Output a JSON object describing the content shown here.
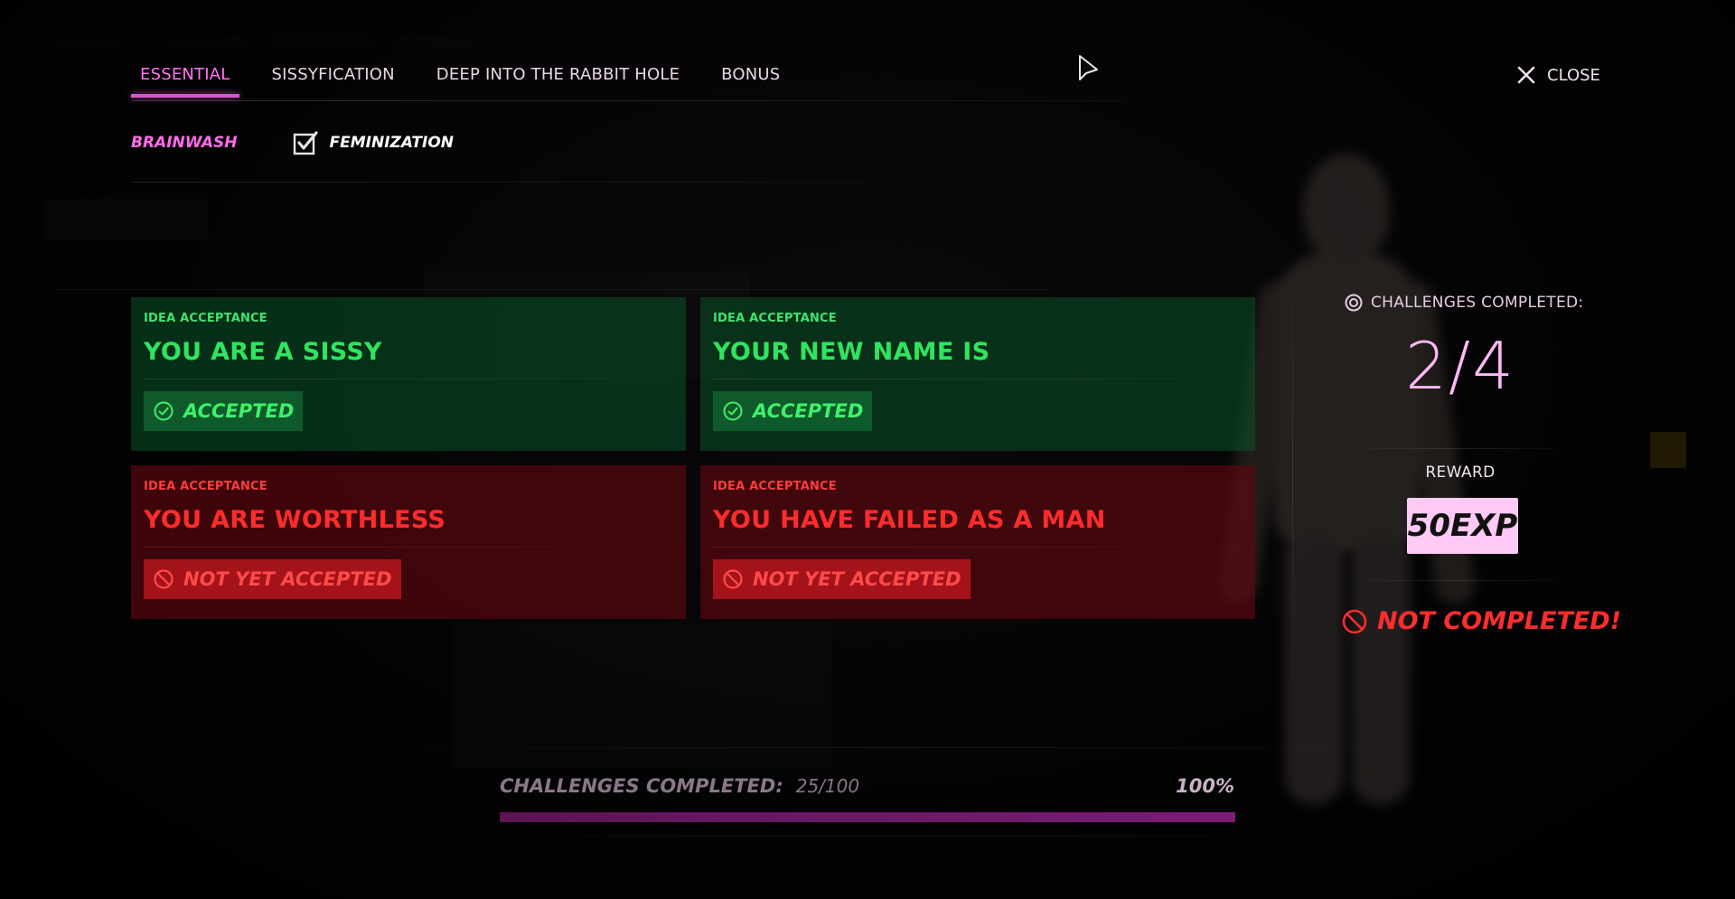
{
  "tabs": [
    {
      "label": "ESSENTIAL",
      "active": true
    },
    {
      "label": "SISSYFICATION",
      "active": false
    },
    {
      "label": "DEEP INTO THE RABBIT HOLE",
      "active": false
    },
    {
      "label": "BONUS",
      "active": false
    }
  ],
  "close_label": "CLOSE",
  "subtabs": [
    {
      "label": "BRAINWASH",
      "active": true
    },
    {
      "label": "FEMINIZATION",
      "active": false,
      "icon": "checkbox-checked-icon"
    }
  ],
  "cards": [
    {
      "category": "IDEA ACCEPTANCE",
      "title": "YOU ARE A SISSY",
      "status": "ACCEPTED",
      "state": "accepted"
    },
    {
      "category": "IDEA ACCEPTANCE",
      "title": "YOUR NEW NAME IS",
      "status": "ACCEPTED",
      "state": "accepted"
    },
    {
      "category": "IDEA ACCEPTANCE",
      "title": "YOU ARE WORTHLESS",
      "status": "NOT YET ACCEPTED",
      "state": "pending"
    },
    {
      "category": "IDEA ACCEPTANCE",
      "title": "YOU HAVE FAILED AS A MAN",
      "status": "NOT YET ACCEPTED",
      "state": "pending"
    }
  ],
  "panel": {
    "challenges_label": "CHALLENGES COMPLETED:",
    "challenges_count": "2/4",
    "reward_label": "REWARD",
    "reward_value": "50EXP",
    "result": "NOT COMPLETED!"
  },
  "progress": {
    "label": "CHALLENGES COMPLETED:",
    "value": "25/100",
    "percent": "100%",
    "fill_fraction": 1.0
  },
  "colors": {
    "accent_pink": "#ff74ef",
    "accepted_green": "#2fe45f",
    "pending_red": "#ff2c2c",
    "reward_badge": "#ffc9f5"
  }
}
